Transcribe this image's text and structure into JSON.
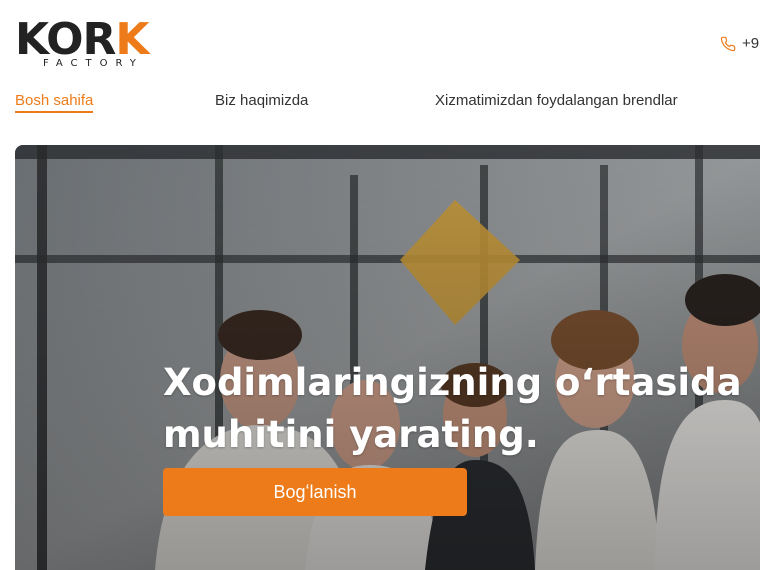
{
  "brand": {
    "logo_word": "KORK",
    "logo_sub": "FACTORY",
    "accent": "#ee7b1a"
  },
  "header": {
    "phone": "+9",
    "phone_icon": "phone-icon"
  },
  "nav": [
    {
      "label": "Bosh sahifa",
      "active": true
    },
    {
      "label": "Biz haqimizda",
      "active": false
    },
    {
      "label": "Xizmatimizdan foydalangan brendlar",
      "active": false
    }
  ],
  "hero": {
    "title_line1": "Xodimlaringizning oʻrtasida ",
    "title_line2": "muhitini yarating.",
    "cta_label": "Bogʻlanish"
  }
}
